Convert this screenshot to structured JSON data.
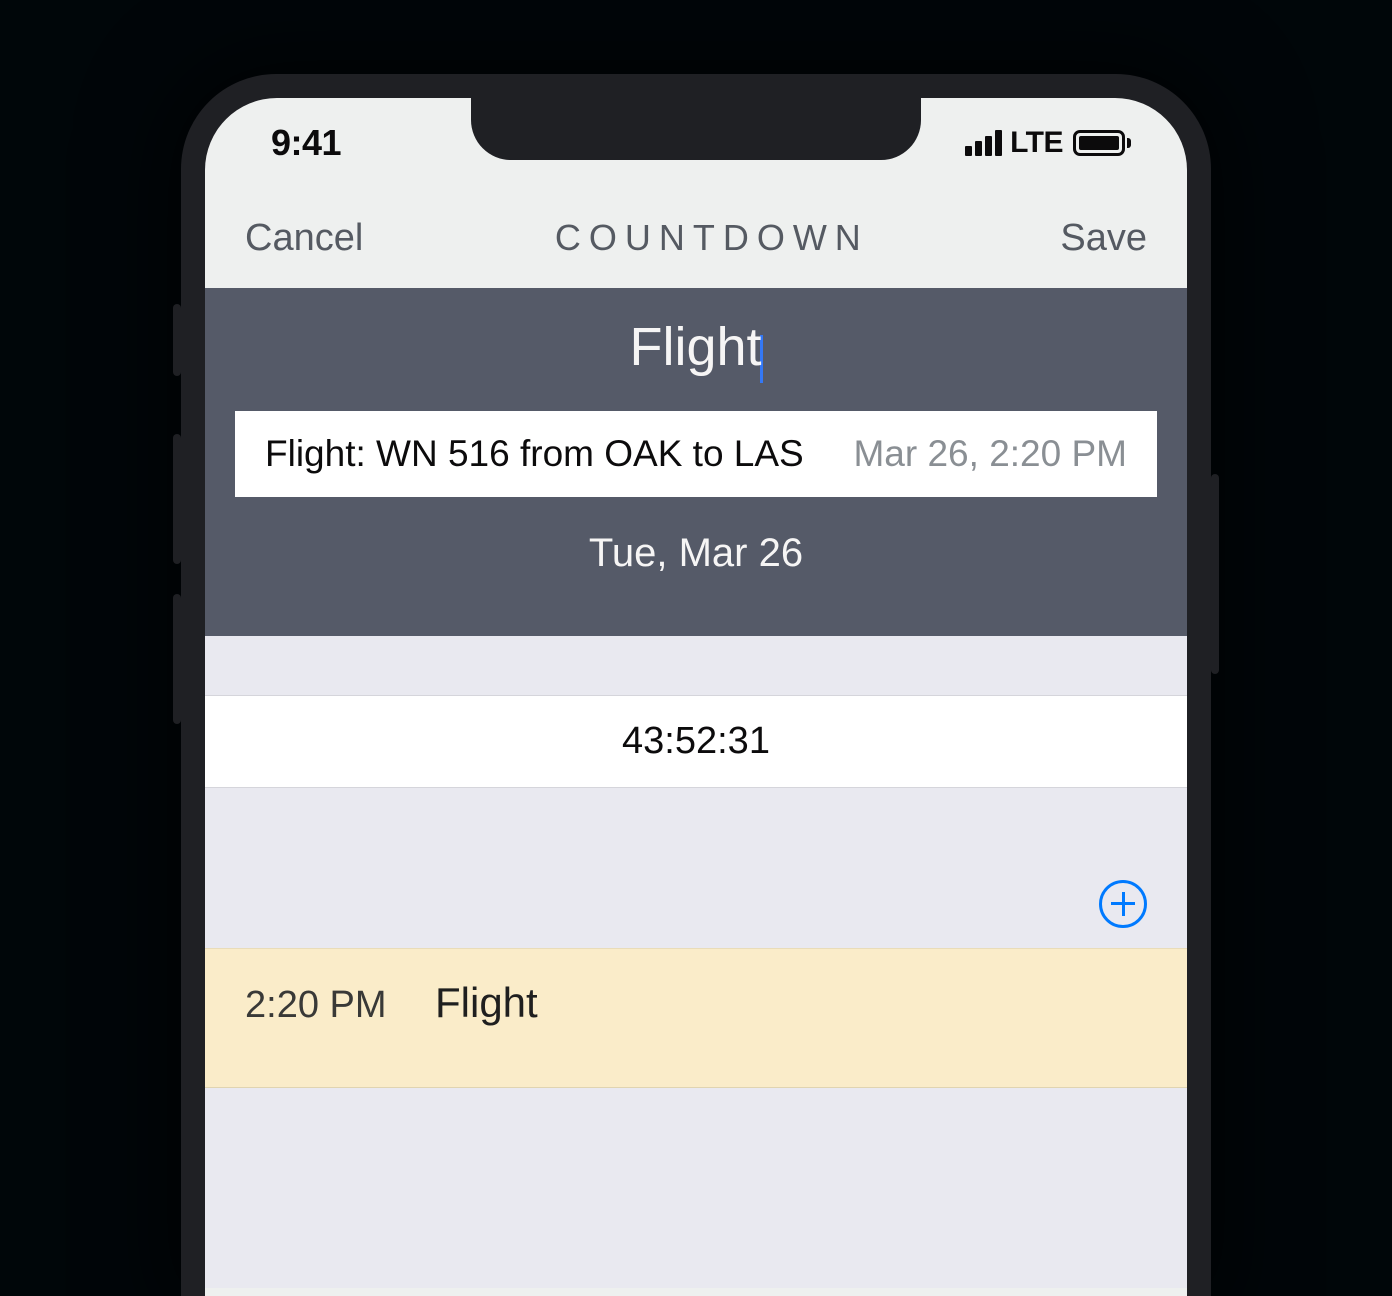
{
  "status": {
    "time": "9:41",
    "network": "LTE"
  },
  "nav": {
    "cancel": "Cancel",
    "title": "COUNTDOWN",
    "save": "Save"
  },
  "editor": {
    "title_input": "Flight",
    "suggestion": {
      "main": "Flight: WN 516 from OAK to LAS",
      "date": "Mar 26, 2:20 PM"
    },
    "date_label": "Tue, Mar 26"
  },
  "countdown": {
    "remaining": "43:52:31"
  },
  "calendar": {
    "event": {
      "time": "2:20 PM",
      "name": "Flight"
    }
  }
}
